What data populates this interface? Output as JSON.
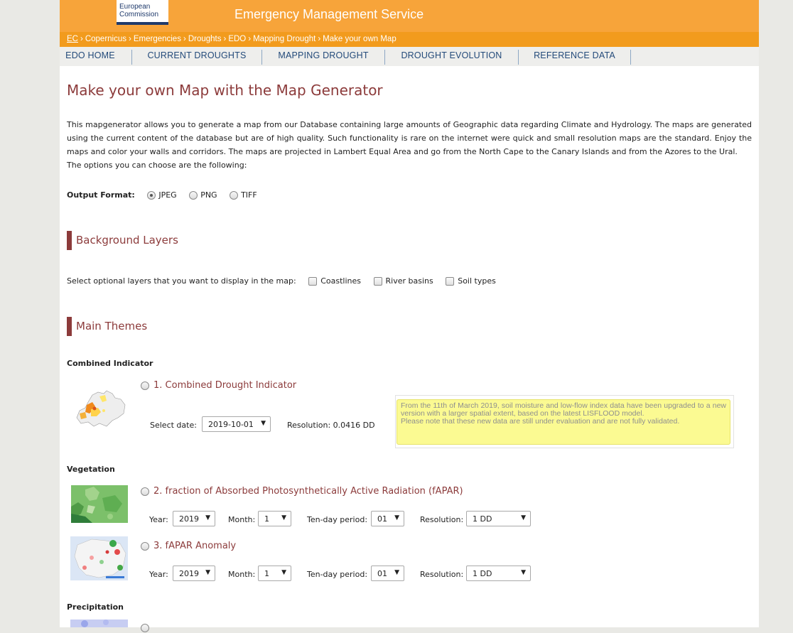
{
  "header": {
    "logo_line1": "European",
    "logo_line2": "Commission",
    "service_title": "Emergency Management Service"
  },
  "breadcrumb": [
    "EC",
    "Copernicus",
    "Emergencies",
    "Droughts",
    "EDO",
    "Mapping Drought",
    "Make your own Map"
  ],
  "nav": [
    "EDO HOME",
    "CURRENT DROUGHTS",
    "MAPPING DROUGHT",
    "DROUGHT EVOLUTION",
    "REFERENCE DATA"
  ],
  "page_title": "Make your own Map with the Map Generator",
  "intro": {
    "p1": "This mapgenerator allows you to generate a map from our Database containing large amounts of Geographic data regarding Climate and Hydrology. The maps are generated using the current content of the database but are of high quality. Such functionality is rare on the internet were quick and small resolution maps are the standard. Enjoy the maps and color your walls and corridors. The maps are projected in Lambert Equal Area and go from the North Cape to the Canary Islands and from the Azores to the Ural.",
    "p2": "The options you can choose are the following:"
  },
  "output_format": {
    "label": "Output Format:",
    "options": [
      "JPEG",
      "PNG",
      "TIFF"
    ],
    "selected": "JPEG"
  },
  "background_layers": {
    "heading": "Background Layers",
    "prompt": "Select optional layers that you want to display in the map:",
    "options": [
      "Coastlines",
      "River basins",
      "Soil types"
    ]
  },
  "main_themes": {
    "heading": "Main Themes",
    "combined": {
      "group": "Combined Indicator",
      "title": "1. Combined Drought Indicator",
      "date_label": "Select date:",
      "date_value": "2019-10-01",
      "resolution_text": "Resolution: 0.0416 DD",
      "notice_p1": "From the 11th of March 2019, soil moisture and low-flow index data have been upgraded to a new version with a larger spatial extent, based on the latest LISFLOOD model.",
      "notice_p2": "Please note that these new data are still under evaluation and are not fully validated."
    },
    "vegetation": {
      "group": "Vegetation",
      "items": [
        {
          "title": "2. fraction of Absorbed Photosynthetically Active Radiation (fAPAR)",
          "year": "2019",
          "month": "1",
          "period": "01",
          "resolution": "1 DD"
        },
        {
          "title": "3. fAPAR Anomaly",
          "year": "2019",
          "month": "1",
          "period": "01",
          "resolution": "1 DD"
        }
      ]
    },
    "labels": {
      "year": "Year:",
      "month": "Month:",
      "period": "Ten-day period:",
      "resolution": "Resolution:"
    },
    "precipitation": {
      "group": "Precipitation"
    }
  }
}
